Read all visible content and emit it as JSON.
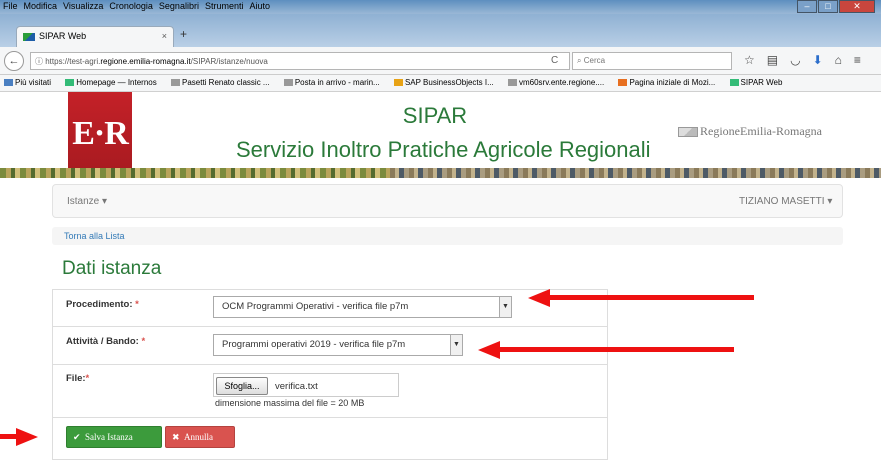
{
  "browser": {
    "menu": [
      "File",
      "Modifica",
      "Visualizza",
      "Cronologia",
      "Segnalibri",
      "Strumenti",
      "Aiuto"
    ],
    "tab_title": "SIPAR Web",
    "url_prefix": "https://test-agri.",
    "url_domain": "regione.emilia-romagna.it",
    "url_path": "/SIPAR/istanze/nuova",
    "search_placeholder": "Cerca",
    "bookmarks": [
      "Più visitati",
      "Homepage — Internos",
      "Pasetti Renato classic ...",
      "Posta in arrivo - marin...",
      "SAP BusinessObjects I...",
      "vm60srv.ente.regione....",
      "Pagina iniziale di Mozi...",
      "SIPAR Web"
    ]
  },
  "header": {
    "logo": "E·R",
    "title": "SIPAR",
    "subtitle": "Servizio Inoltro Pratiche Agricole Regionali",
    "region": "RegioneEmilia-Romagna"
  },
  "nav": {
    "menu_label": "Istanze ▾",
    "user_label": "TIZIANO MASETTI ▾"
  },
  "breadcrumb": "Torna alla Lista",
  "page_title": "Dati istanza",
  "form": {
    "procedimento_label": "Procedimento:",
    "procedimento_value": "OCM Programmi Operativi - verifica file p7m",
    "attivita_label": "Attività / Bando:",
    "attivita_value": "Programmi operativi 2019 - verifica file p7m",
    "file_label": "File:",
    "required_mark": "*",
    "browse_label": "Sfoglia...",
    "file_value": "verifica.txt",
    "file_hint": "dimensione massima del file = 20 MB"
  },
  "buttons": {
    "save": "Salva Istanza",
    "cancel": "Annulla"
  },
  "colors": {
    "accent_green": "#2b7a3a",
    "logo_red": "#c42128",
    "arrow_red": "#e11111"
  }
}
